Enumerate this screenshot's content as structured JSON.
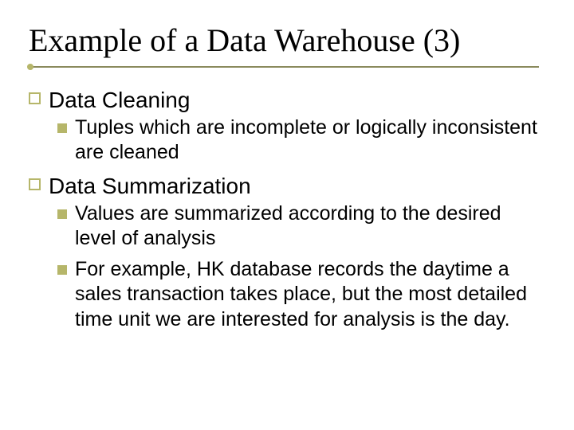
{
  "title": "Example of a Data Warehouse (3)",
  "sections": [
    {
      "heading": "Data Cleaning",
      "items": [
        "Tuples which are incomplete or logically inconsistent are cleaned"
      ]
    },
    {
      "heading": "Data Summarization",
      "items": [
        "Values are summarized according to the desired level of analysis",
        "For example, HK database records the daytime a sales transaction takes place, but the most detailed time unit we are interested for analysis is the day."
      ]
    }
  ]
}
